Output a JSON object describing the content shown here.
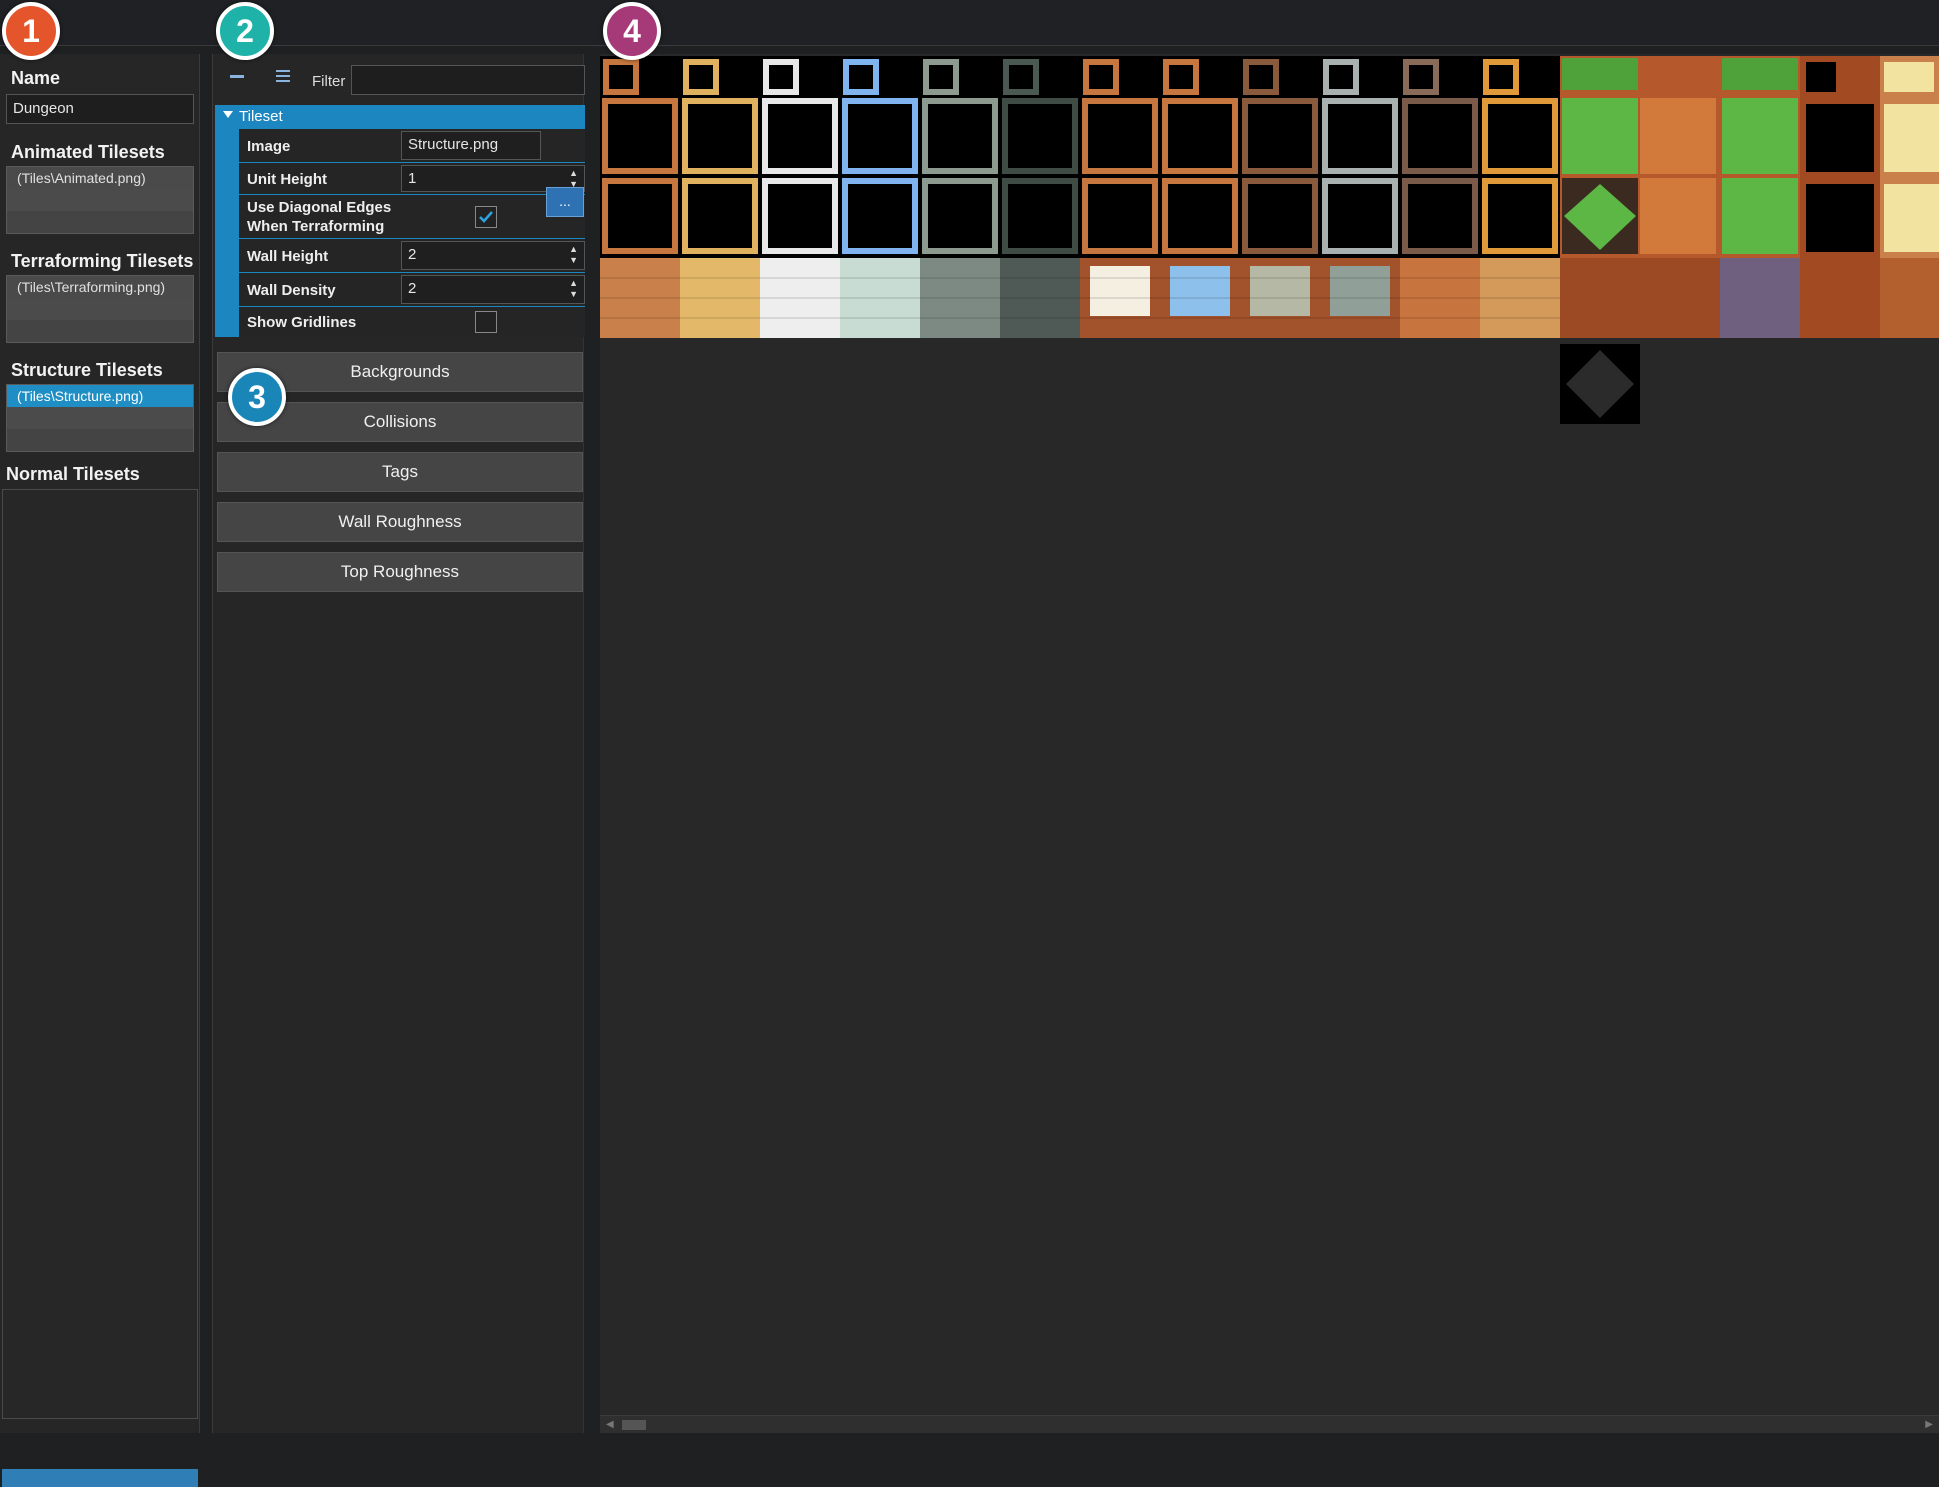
{
  "callouts": [
    "1",
    "2",
    "3",
    "4"
  ],
  "colors": {
    "callout_1": "#e4552b",
    "callout_2": "#1fb2a8",
    "callout_3": "#1a86b8",
    "callout_4": "#a63a78",
    "selection": "#1e8ec4"
  },
  "left": {
    "name_label": "Name",
    "name_value": "Dungeon",
    "animated_label": "Animated Tilesets",
    "animated_items": [
      "(Tiles\\Animated.png)"
    ],
    "terraforming_label": "Terraforming Tilesets",
    "terraforming_items": [
      "(Tiles\\Terraforming.png)"
    ],
    "structure_label": "Structure Tilesets",
    "structure_items": [
      "(Tiles\\Structure.png)"
    ],
    "normal_label": "Normal Tilesets"
  },
  "toolbar": {
    "collapse_icon": "minus-icon",
    "list_icon": "list-icon",
    "filter_label": "Filter",
    "filter_value": ""
  },
  "property_grid": {
    "category": "Tileset",
    "image_label": "Image",
    "image_value": "Structure.png",
    "browse_label": "...",
    "unit_height_label": "Unit Height",
    "unit_height_value": "1",
    "diagonal_label_1": "Use Diagonal Edges",
    "diagonal_label_2": "When Terraforming",
    "diagonal_checked": true,
    "wall_height_label": "Wall Height",
    "wall_height_value": "2",
    "wall_density_label": "Wall Density",
    "wall_density_value": "2",
    "gridlines_label": "Show Gridlines",
    "gridlines_checked": false
  },
  "categories": [
    "Backgrounds",
    "Collisions",
    "Tags",
    "Wall Roughness",
    "Top Roughness"
  ]
}
